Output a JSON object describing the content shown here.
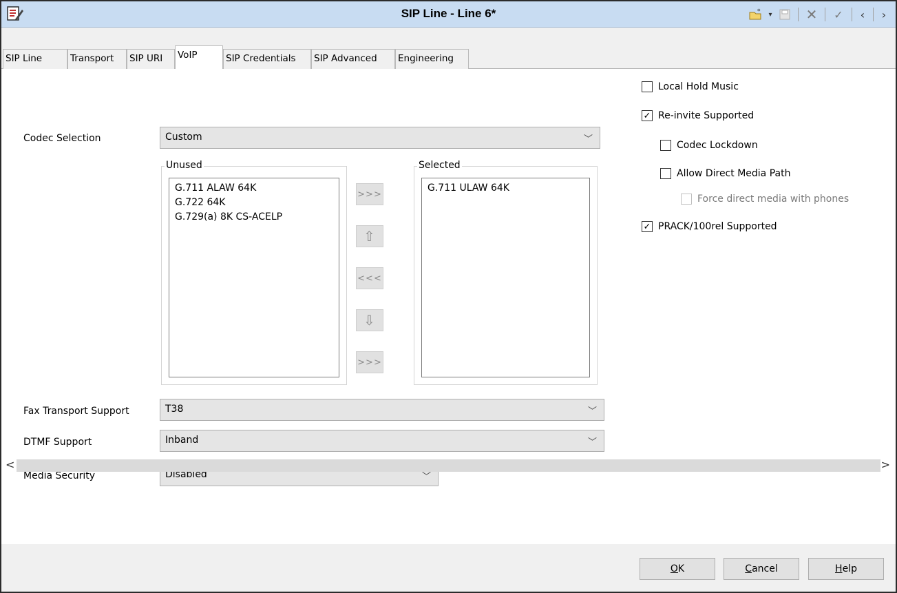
{
  "window": {
    "title": "SIP Line - Line 6*",
    "toolbar_icons": [
      "new-icon",
      "dropdown-icon",
      "save-icon",
      "delete-icon",
      "validate-icon",
      "previous-icon",
      "next-icon"
    ]
  },
  "tabs": [
    {
      "label": "SIP Line"
    },
    {
      "label": "Transport"
    },
    {
      "label": "SIP URI"
    },
    {
      "label": "VoIP",
      "active": true
    },
    {
      "label": "SIP Credentials"
    },
    {
      "label": "SIP Advanced"
    },
    {
      "label": "Engineering"
    }
  ],
  "codec": {
    "label": "Codec Selection",
    "value": "Custom",
    "unused_legend": "Unused",
    "unused": [
      "G.711 ALAW 64K",
      "G.722 64K",
      "G.729(a) 8K CS-ACELP"
    ],
    "selected_legend": "Selected",
    "selected": [
      "G.711 ULAW 64K"
    ],
    "buttons": {
      "add": ">>>",
      "up": "⇧",
      "remove": "<<<",
      "down": "⇩",
      "add_all": ">>>"
    }
  },
  "fax": {
    "label": "Fax Transport Support",
    "value": "T38"
  },
  "dtmf": {
    "label": "DTMF Support",
    "value": "Inband"
  },
  "media_security": {
    "label": "Media Security",
    "value": "Disabled"
  },
  "options": [
    {
      "label": "Local Hold Music",
      "checked": false
    },
    {
      "label": "Re-invite Supported",
      "checked": true
    },
    {
      "label": "Codec Lockdown",
      "checked": false
    },
    {
      "label": "Allow Direct Media Path",
      "checked": false
    },
    {
      "label": "Force direct media with phones",
      "checked": false,
      "disabled": true
    },
    {
      "label": "PRACK/100rel Supported",
      "checked": true
    }
  ],
  "scroll": {
    "left": "<",
    "right": ">"
  },
  "footer": {
    "ok": {
      "access": "O",
      "rest": "K"
    },
    "cancel": {
      "access": "C",
      "rest": "ancel"
    },
    "help": {
      "access": "H",
      "rest": "elp"
    }
  }
}
